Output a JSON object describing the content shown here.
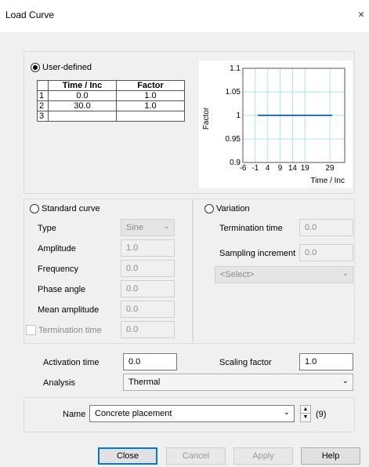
{
  "window": {
    "title": "Load Curve",
    "close_symbol": "×"
  },
  "user_defined": {
    "label": "User-defined",
    "selected": true,
    "table": {
      "headers": [
        "Time / Inc",
        "Factor"
      ],
      "rows": [
        {
          "num": "1",
          "time": "0.0",
          "factor": "1.0"
        },
        {
          "num": "2",
          "time": "30.0",
          "factor": "1.0"
        },
        {
          "num": "3",
          "time": "",
          "factor": ""
        }
      ]
    }
  },
  "chart_data": {
    "type": "line",
    "xlabel": "Time / Inc",
    "ylabel": "Factor",
    "x_tick_labels": [
      "-6",
      "-1",
      "4",
      "9",
      "14",
      "19",
      "29"
    ],
    "x_ticks": [
      -6,
      -1,
      4,
      9,
      14,
      19,
      29
    ],
    "y_tick_labels": [
      "0.9",
      "0.95",
      "1",
      "1.05",
      "1.1"
    ],
    "xlim": [
      -6,
      35
    ],
    "ylim": [
      0.9,
      1.1
    ],
    "grid": true,
    "series": [
      {
        "x": [
          0,
          30
        ],
        "y": [
          1.0,
          1.0
        ],
        "color": "#1f77c4"
      }
    ]
  },
  "standard_curve": {
    "label": "Standard curve",
    "type_label": "Type",
    "type_value": "Sine",
    "amplitude_label": "Amplitude",
    "amplitude_value": "1.0",
    "frequency_label": "Frequency",
    "frequency_value": "0.0",
    "phase_label": "Phase angle",
    "phase_value": "0.0",
    "mean_label": "Mean amplitude",
    "mean_value": "0.0",
    "termination_label": "Termination time",
    "termination_value": "0.0"
  },
  "variation": {
    "label": "Variation",
    "termination_label": "Termination time",
    "termination_value": "0.0",
    "sampling_label": "Sampling increment",
    "sampling_value": "0.0",
    "select_value": "<Select>"
  },
  "activation": {
    "label": "Activation time",
    "value": "0.0"
  },
  "scaling": {
    "label": "Scaling factor",
    "value": "1.0"
  },
  "analysis": {
    "label": "Analysis",
    "value": "Thermal"
  },
  "name": {
    "label": "Name",
    "value": "Concrete placement",
    "count": "(9)"
  },
  "buttons": {
    "close": "Close",
    "cancel": "Cancel",
    "apply": "Apply",
    "help": "Help"
  },
  "colors": {
    "accent": "#0078d7",
    "line": "#1f77c4",
    "grid": "#b0e3e8"
  }
}
